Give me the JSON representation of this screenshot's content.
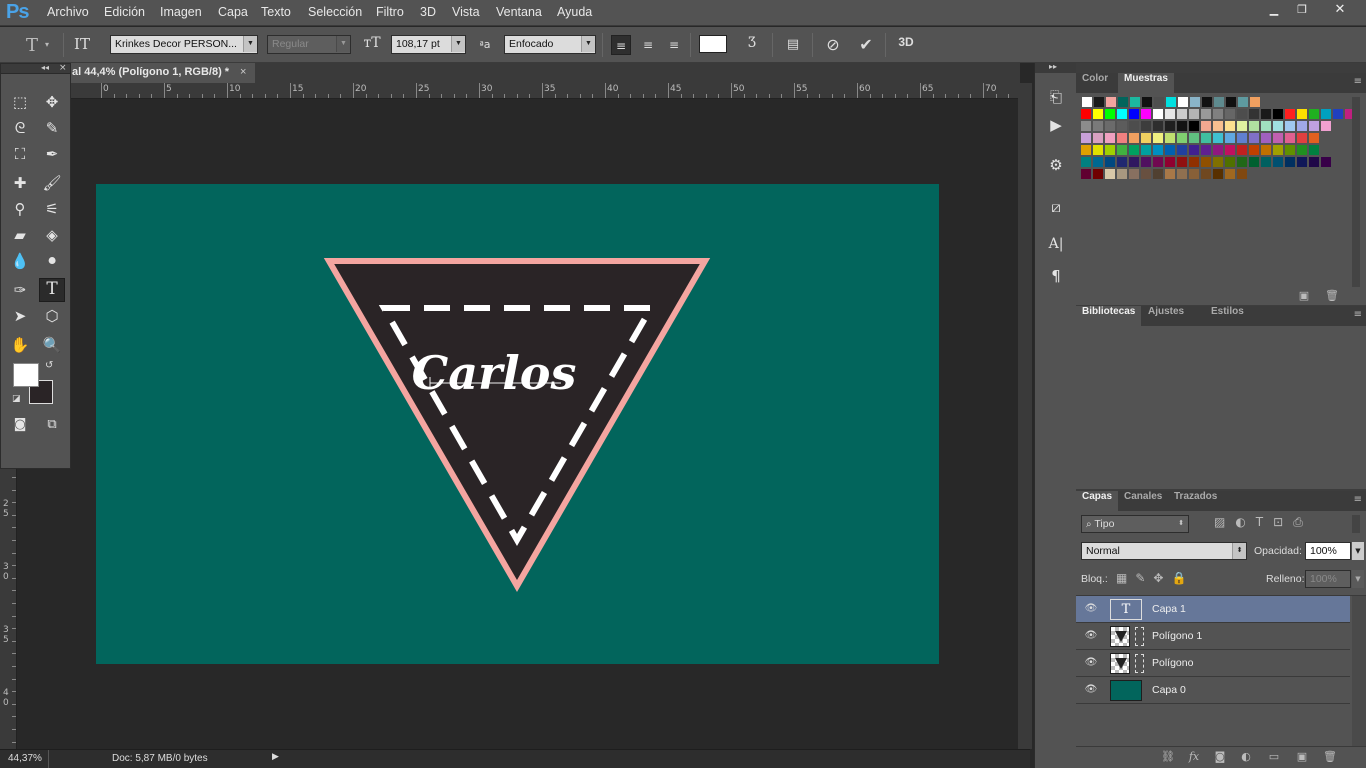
{
  "app": {
    "logo": "Ps",
    "menu": [
      "Archivo",
      "Edición",
      "Imagen",
      "Capa",
      "Texto",
      "Selección",
      "Filtro",
      "3D",
      "Vista",
      "Ventana",
      "Ayuda"
    ],
    "window_buttons": [
      "minimize-icon",
      "restore-icon",
      "close-icon"
    ]
  },
  "options": {
    "font_family": "Krinkes Decor PERSON...",
    "font_style": "Regular",
    "font_size": "108,17 pt",
    "aa_label": "a",
    "antialias": "Enfocado",
    "text_color": "#ffffff"
  },
  "document": {
    "tab_title": "al 44,4% (Polígono 1, RGB/8) *",
    "tab_close": "×",
    "zoom": "44,37%",
    "doc_info": "Doc: 5,87 MB/0 bytes"
  },
  "rulers": {
    "top": [
      "0",
      "5",
      "10",
      "15",
      "20",
      "25",
      "30",
      "35",
      "40",
      "45",
      "50",
      "55",
      "60",
      "65",
      "70"
    ],
    "left": [
      {
        "a": "2",
        "b": "5"
      },
      {
        "a": "3",
        "b": "0"
      },
      {
        "a": "3",
        "b": "5"
      },
      {
        "a": "4",
        "b": "0"
      }
    ]
  },
  "canvas": {
    "bg": "#02655c",
    "triangle_outline": "#f4a5a0",
    "triangle_fill": "#2a2426",
    "text": "Carlos"
  },
  "right": {
    "dock_icons": [
      "history-icon",
      "play-actions-icon",
      "properties-icon",
      "clone-source-icon",
      "character-icon",
      "paragraph-icon"
    ],
    "color_panel": {
      "tabs": [
        "Color",
        "Muestras"
      ],
      "active": 1
    },
    "libraries_panel": {
      "tabs": [
        "Bibliotecas",
        "Ajustes",
        "Estilos"
      ],
      "active": 0
    },
    "layers_panel": {
      "tabs": [
        "Capas",
        "Canales",
        "Trazados"
      ],
      "active": 0,
      "filter": "Tipo",
      "blend_mode": "Normal",
      "opacity_label": "Opacidad:",
      "opacity": "100%",
      "lock_label": "Bloq.:",
      "fill_label": "Relleno:",
      "fill": "100%",
      "layers": [
        {
          "name": "Capa 1",
          "type": "text",
          "thumb": "T",
          "selected": true
        },
        {
          "name": "Polígono 1",
          "type": "shape",
          "thumb": "",
          "selected": false
        },
        {
          "name": "Polígono",
          "type": "shape",
          "thumb": "",
          "selected": false
        },
        {
          "name": "Capa 0",
          "type": "fill",
          "thumb": "",
          "selected": false
        }
      ]
    }
  },
  "swatches": {
    "rows": [
      [
        "#ffffff",
        "#1a1a1a",
        "#f4a5a0",
        "#02655c",
        "#1cb8a0",
        "#111111",
        "#4e4e4e",
        "#00e0e0",
        "#ffffff",
        "#8ab4c8",
        "#111111",
        "#5e8a8e",
        "#101010",
        "#5e9aa0",
        "#f0a060"
      ],
      [
        "#ff0000",
        "#ffff00",
        "#00ff00",
        "#00ffff",
        "#0000ff",
        "#ff00ff",
        "#ffffff",
        "#e6e6e6",
        "#cccccc",
        "#b3b3b3",
        "#999999",
        "#808080",
        "#666666",
        "#4d4d4d",
        "#333333",
        "#1a1a1a",
        "#000000",
        "#ff2020",
        "#ffe000",
        "#20b020",
        "#00a0c0",
        "#2040c0",
        "#c02080"
      ],
      [
        "#8c8c8c",
        "#7a7a7a",
        "#6b6b6b",
        "#5c5c5c",
        "#4d4d4d",
        "#3d3d3d",
        "#2e2e2e",
        "#1f1f1f",
        "#121212",
        "#000000",
        "#f4a890",
        "#f8c090",
        "#fce090",
        "#e0f0a0",
        "#b0e0a0",
        "#a0e0c0",
        "#a0e0e0",
        "#a0c8f0",
        "#a0a8e8",
        "#c0a0e0",
        "#f0a0d0"
      ],
      [
        "#c8a0d8",
        "#d8a0c0",
        "#f0a0c0",
        "#f08080",
        "#f0a060",
        "#f0d060",
        "#f0f080",
        "#c0e070",
        "#80d070",
        "#60c080",
        "#40c0a0",
        "#40c0d0",
        "#60a8e0",
        "#6080d0",
        "#8070c8",
        "#a060c0",
        "#c060b0",
        "#e06090",
        "#e04040",
        "#e06020"
      ],
      [
        "#e0a000",
        "#e0e000",
        "#a0d000",
        "#40b040",
        "#00a060",
        "#00a0a0",
        "#0090c0",
        "#0060b0",
        "#2040a0",
        "#402090",
        "#602090",
        "#901880",
        "#c01060",
        "#c02020",
        "#c04000",
        "#c07000",
        "#a0a000",
        "#609000",
        "#209020",
        "#008040"
      ],
      [
        "#008080",
        "#006890",
        "#004880",
        "#202870",
        "#301860",
        "#501060",
        "#700850",
        "#900030",
        "#901010",
        "#903000",
        "#905000",
        "#807000",
        "#507000",
        "#206818",
        "#006030",
        "#006060",
        "#005070",
        "#003060",
        "#101858",
        "#200848",
        "#380048"
      ],
      [
        "#600030",
        "#700000",
        "#d8c8a8",
        "#a89880",
        "#887060",
        "#685040",
        "#504030",
        "#a87848",
        "#907050",
        "#886038",
        "#704820",
        "#583000",
        "#a06820",
        "#804810"
      ]
    ]
  }
}
